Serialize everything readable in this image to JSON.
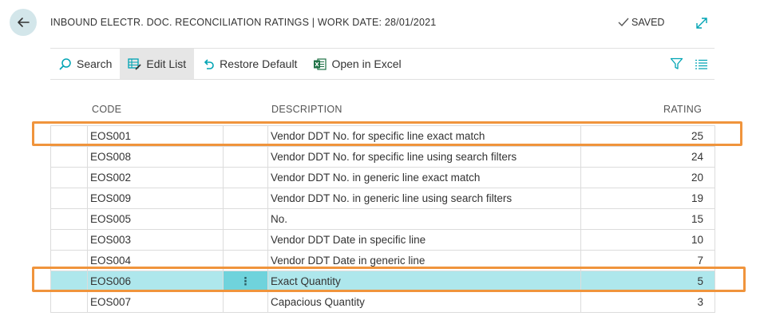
{
  "header": {
    "title": "INBOUND ELECTR. DOC. RECONCILIATION RATINGS | WORK DATE: 28/01/2021",
    "saved_label": "SAVED"
  },
  "toolbar": {
    "search_label": "Search",
    "edit_list_label": "Edit List",
    "restore_default_label": "Restore Default",
    "open_excel_label": "Open in Excel"
  },
  "columns": {
    "code": "CODE",
    "description": "DESCRIPTION",
    "rating": "RATING"
  },
  "rows": [
    {
      "code": "EOS001",
      "description": "Vendor DDT No. for specific line exact match",
      "rating": "25"
    },
    {
      "code": "EOS008",
      "description": "Vendor DDT No. for specific line using search filters",
      "rating": "24"
    },
    {
      "code": "EOS002",
      "description": "Vendor DDT No. in generic line exact match",
      "rating": "20"
    },
    {
      "code": "EOS009",
      "description": "Vendor DDT No. in generic line using search filters",
      "rating": "19"
    },
    {
      "code": "EOS005",
      "description": "No.",
      "rating": "15"
    },
    {
      "code": "EOS003",
      "description": "Vendor DDT Date in specific line",
      "rating": "10"
    },
    {
      "code": "EOS004",
      "description": "Vendor DDT Date in generic line",
      "rating": "7"
    },
    {
      "code": "EOS006",
      "description": "Exact Quantity",
      "rating": "5"
    },
    {
      "code": "EOS007",
      "description": "Capacious Quantity",
      "rating": "3"
    }
  ],
  "selected_row_index": 7,
  "colors": {
    "accent": "#00a4b4",
    "selected_row": "#aee7ec",
    "highlight_box": "#f0943c"
  }
}
